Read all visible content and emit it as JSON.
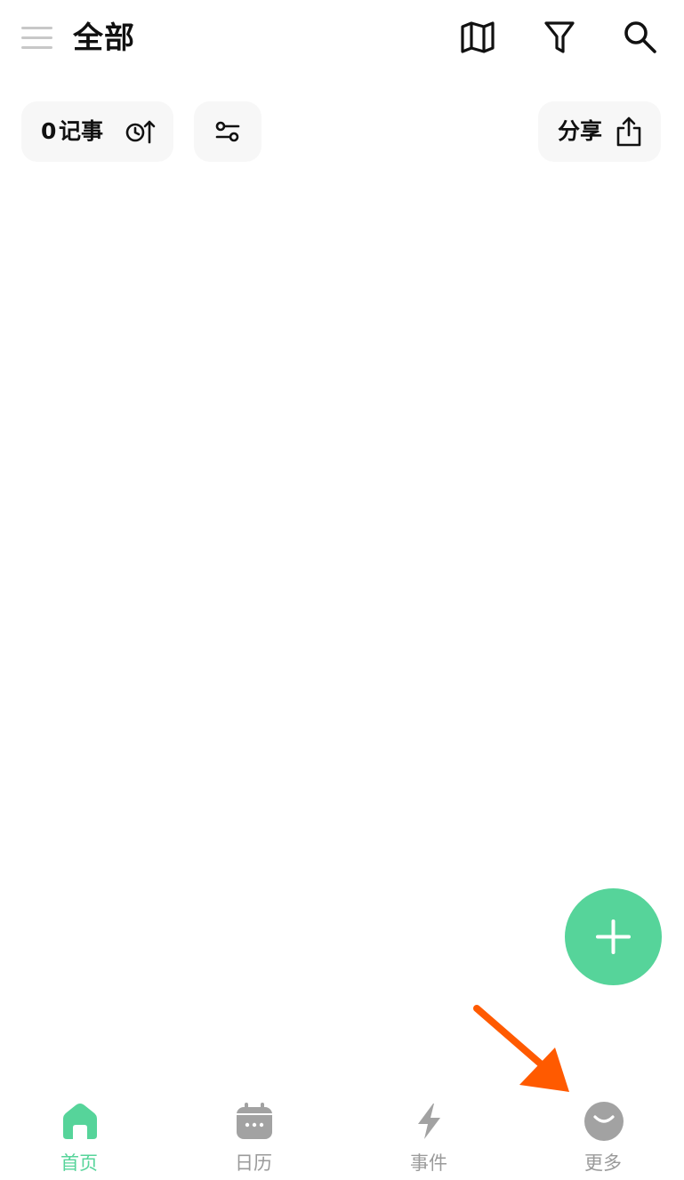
{
  "header": {
    "title": "全部",
    "icons": [
      "menu-icon",
      "map-icon",
      "filter-icon",
      "search-icon"
    ]
  },
  "toolbar": {
    "count": "0",
    "count_label": "记事",
    "share_label": "分享",
    "icons": [
      "sort-time-icon",
      "adjust-icon",
      "share-icon"
    ]
  },
  "fab": {
    "icon": "plus-icon",
    "color": "#56d49a"
  },
  "tabs": [
    {
      "label": "首页",
      "icon": "home-icon",
      "active": true
    },
    {
      "label": "日历",
      "icon": "calendar-icon",
      "active": false
    },
    {
      "label": "事件",
      "icon": "lightning-icon",
      "active": false
    },
    {
      "label": "更多",
      "icon": "smile-icon",
      "active": false
    }
  ],
  "colors": {
    "accent": "#56d49a",
    "inactive": "#9a9a9a",
    "chip_bg": "#f7f7f7",
    "annotation_arrow": "#ff5a00"
  }
}
